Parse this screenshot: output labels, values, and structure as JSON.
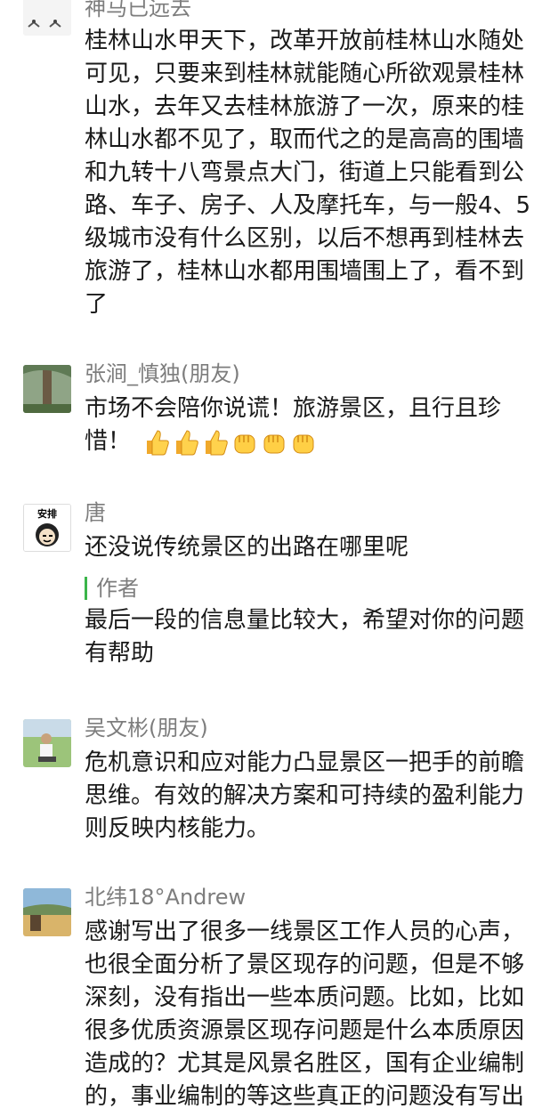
{
  "comments": [
    {
      "name": "神马已远去",
      "lines": [
        "桂林山水甲天下，改革开放前桂林山水随处",
        "可见，只要来到桂林就能随心所欲观景桂林",
        "山水，去年又去桂林旅游了一次，原来的桂",
        "林山水都不见了，取而代之的是高高的围墙",
        "和九转十八弯景点大门，街道上只能看到公",
        "路、车子、房子、人及摩托车，与一般4、5",
        "级城市没有什么区别，以后不想再到桂林去",
        "旅游了，桂林山水都用围墙围上了，看不到",
        "了"
      ]
    },
    {
      "name": "张涧_慎独(朋友)",
      "lines": [
        "市场不会陪你说谎！旅游景区，且行且珍",
        "惜！"
      ],
      "emoji_icons": [
        "thumbs-up-icon",
        "thumbs-up-icon",
        "thumbs-up-icon",
        "fist-icon",
        "fist-icon",
        "fist-icon"
      ]
    },
    {
      "name": "唐",
      "avatar_text": "安排",
      "lines": [
        "还没说传统景区的出路在哪里呢"
      ],
      "reply": {
        "tag": "作者",
        "lines": [
          "最后一段的信息量比较大，希望对你的问题",
          "有帮助"
        ]
      }
    },
    {
      "name": "吴文彬(朋友)",
      "lines": [
        "危机意识和应对能力凸显景区一把手的前瞻",
        "思维。有效的解决方案和可持续的盈利能力",
        "则反映内核能力。"
      ]
    },
    {
      "name": "北纬18°Andrew",
      "lines": [
        "感谢写出了很多一线景区工作人员的心声，",
        "也很全面分析了景区现存的问题，但是不够",
        "深刻，没有指出一些本质问题。比如，比如",
        "很多优质资源景区现存问题是什么本质原因",
        "造成的？尤其是风景名胜区，国有企业编制",
        "的，事业编制的等这些真正的问题没有写出"
      ]
    }
  ],
  "colors": {
    "name_gray": "#7d7d7d",
    "author_bar_green": "#3bb54a",
    "text": "#1a1a1a"
  }
}
